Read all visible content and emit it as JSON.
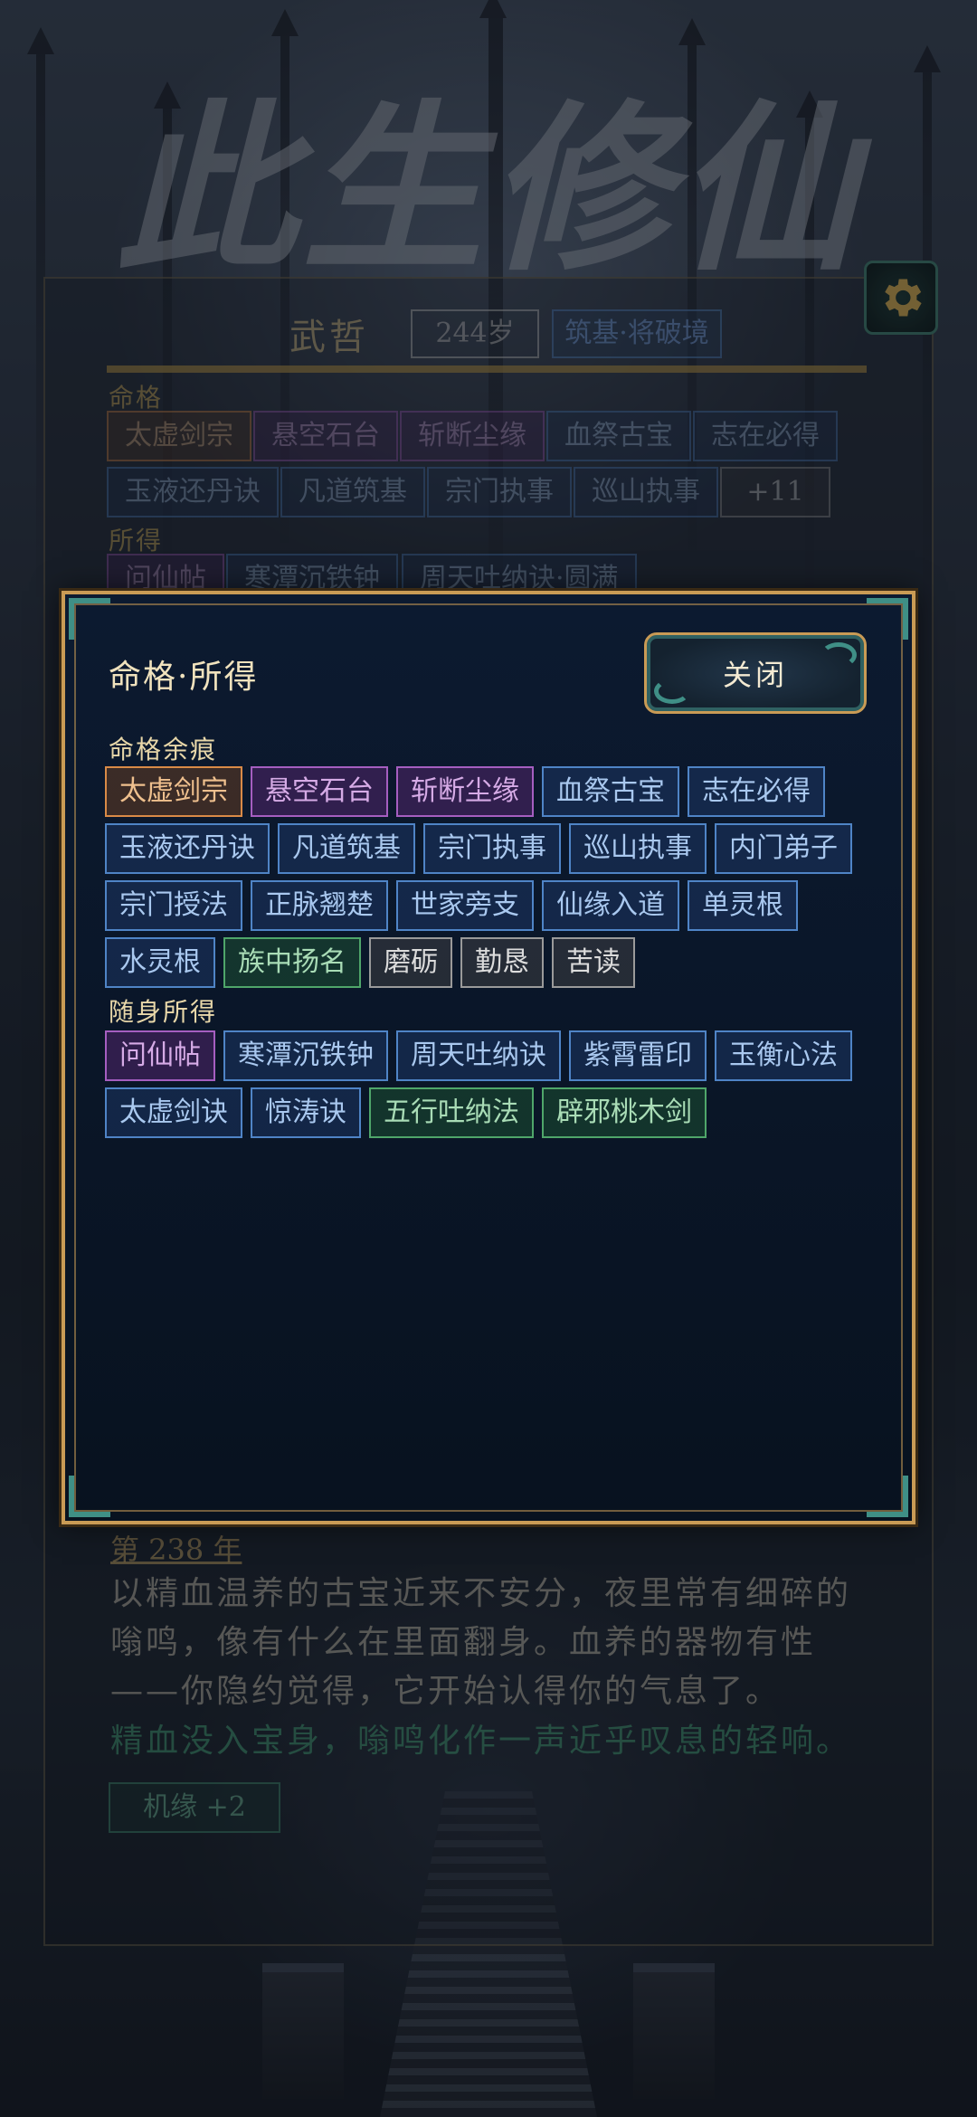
{
  "app": {
    "title": "此生修仙"
  },
  "character": {
    "name": "武哲",
    "age": "244岁",
    "realm": "筑基·将破境"
  },
  "background_panel": {
    "fate_label": "命格",
    "fate_row1": [
      "太虚剑宗",
      "悬空石台",
      "斩断尘缘",
      "血祭古宝",
      "志在必得"
    ],
    "fate_row2": [
      "玉液还丹诀",
      "凡道筑基",
      "宗门执事",
      "巡山执事",
      "+11"
    ],
    "items_label": "所得",
    "items_row1": [
      "问仙帖",
      "寒潭沉铁钟",
      "周天吐纳诀·圆满"
    ]
  },
  "story": {
    "year": "第 238 年",
    "text": "以精血温养的古宝近来不安分，夜里常有细碎的嗡鸣，像有什么在里面翻身。血养的器物有性——你隐约觉得，它开始认得你的气息了。",
    "result": "精血没入宝身，嗡鸣化作一声近乎叹息的轻响。",
    "chance_button": "机缘 +2"
  },
  "modal": {
    "title": "命格·所得",
    "close_label": "关闭",
    "fate_section_label": "命格余痕",
    "fate_tags": [
      [
        {
          "label": "太虚剑宗",
          "color": "orange"
        },
        {
          "label": "悬空石台",
          "color": "purple"
        },
        {
          "label": "斩断尘缘",
          "color": "purple"
        },
        {
          "label": "血祭古宝",
          "color": "blue"
        },
        {
          "label": "志在必得",
          "color": "blue"
        }
      ],
      [
        {
          "label": "玉液还丹诀",
          "color": "blue"
        },
        {
          "label": "凡道筑基",
          "color": "blue"
        },
        {
          "label": "宗门执事",
          "color": "blue"
        },
        {
          "label": "巡山执事",
          "color": "blue"
        },
        {
          "label": "内门弟子",
          "color": "blue"
        }
      ],
      [
        {
          "label": "宗门授法",
          "color": "blue"
        },
        {
          "label": "正脉翘楚",
          "color": "blue"
        },
        {
          "label": "世家旁支",
          "color": "blue"
        },
        {
          "label": "仙缘入道",
          "color": "blue"
        },
        {
          "label": "单灵根",
          "color": "blue"
        }
      ],
      [
        {
          "label": "水灵根",
          "color": "blue"
        },
        {
          "label": "族中扬名",
          "color": "green"
        },
        {
          "label": "磨砺",
          "color": "gray"
        },
        {
          "label": "勤恳",
          "color": "gray"
        },
        {
          "label": "苦读",
          "color": "gray"
        }
      ]
    ],
    "items_section_label": "随身所得",
    "item_tags": [
      [
        {
          "label": "问仙帖",
          "color": "purple"
        },
        {
          "label": "寒潭沉铁钟",
          "color": "blue"
        },
        {
          "label": "周天吐纳诀",
          "color": "blue"
        },
        {
          "label": "紫霄雷印",
          "color": "blue"
        },
        {
          "label": "玉衡心法",
          "color": "blue"
        }
      ],
      [
        {
          "label": "太虚剑诀",
          "color": "blue"
        },
        {
          "label": "惊涛诀",
          "color": "blue"
        },
        {
          "label": "五行吐纳法",
          "color": "green"
        },
        {
          "label": "辟邪桃木剑",
          "color": "green"
        }
      ]
    ]
  },
  "colors": {
    "accent_gold": "#c99b55",
    "accent_teal": "#3f8f86",
    "modal_bg": "#0a1628"
  },
  "icons": {
    "settings": "gear-icon"
  }
}
